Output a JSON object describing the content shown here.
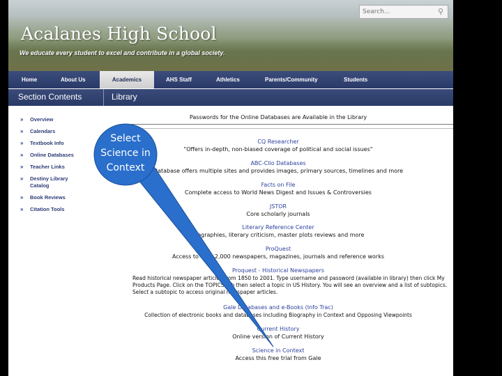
{
  "search": {
    "placeholder": "Search..."
  },
  "banner": {
    "school_name": "Acalanes High School",
    "motto": "We educate every student to excel and contribute in a global society."
  },
  "nav": {
    "items": [
      {
        "label": "Home"
      },
      {
        "label": "About Us"
      },
      {
        "label": "Academics"
      },
      {
        "label": "AHS Staff"
      },
      {
        "label": "Athletics"
      },
      {
        "label": "Parents/Community"
      },
      {
        "label": "Students"
      }
    ],
    "active": "Academics"
  },
  "section": {
    "title": "Section Contents",
    "page_title": "Library"
  },
  "sidebar": {
    "items": [
      {
        "label": "Overview"
      },
      {
        "label": "Calendars"
      },
      {
        "label": "Textbook Info"
      },
      {
        "label": "Online Databases"
      },
      {
        "label": "Teacher Links"
      },
      {
        "label": "Destiny Library Catalog"
      },
      {
        "label": "Book Reviews"
      },
      {
        "label": "Citation Tools"
      }
    ]
  },
  "content": {
    "passwords_note": "Passwords for the Online Databases are Available in the Library",
    "databases": [
      {
        "title": "CQ Researcher",
        "desc": "\"Offers in-depth, non-biased coverage of political and social issues\""
      },
      {
        "title": "ABC-Clio Databases",
        "desc": "Database offers multiple sites and provides images, primary sources, timelines and more"
      },
      {
        "title": "Facts on File",
        "desc": "Complete access to World News Digest and Issues & Controversies"
      },
      {
        "title": "JSTOR",
        "desc": "Core scholarly journals"
      },
      {
        "title": "Literary Reference Center",
        "desc": "Biographies, literary criticism, master plots reviews and more"
      },
      {
        "title": "ProQuest",
        "desc": "Access to over 2,000 newspapers, magazines, journals and reference works"
      },
      {
        "title": "Proquest - Historical Newspapers",
        "desc": "Read historical newspaper articles from 1850 to 2001. Type username and password (available in library) then click My Products Page. Click on the TOPICS tab then select a topic in US History. You will see an overview and a list of subtopics. Select a subtopic to access original newspaper articles."
      },
      {
        "title": "Gale Databases and e-Books (Info Trac)",
        "desc": "Collection of electronic books and databases including Biography in Context and Opposing Viewpoints"
      },
      {
        "title": "Current History",
        "desc": "Online version of Current History"
      },
      {
        "title": "Science in Context",
        "desc": "Access this free trial from Gale"
      }
    ]
  },
  "callout": {
    "text": "Select Science in Context",
    "color": "#2a6fcb"
  }
}
